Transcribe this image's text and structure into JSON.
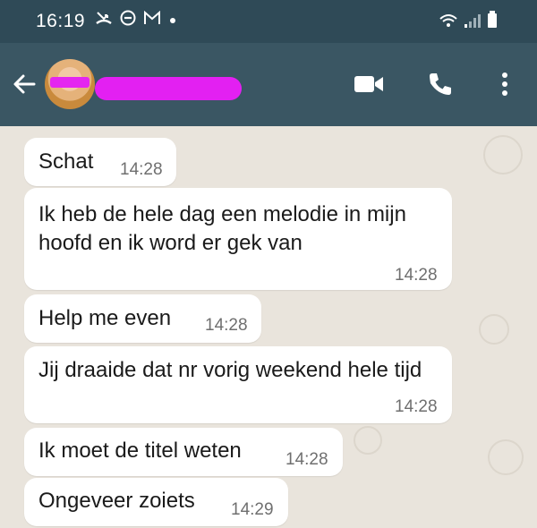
{
  "status_bar": {
    "time": "16:19",
    "icons": [
      "missed-call-icon",
      "do-not-disturb-icon",
      "gmail-icon",
      "notification-dot-icon"
    ],
    "right_icons": [
      "wifi-icon",
      "signal-icon",
      "battery-icon"
    ]
  },
  "app_bar": {
    "contact_name": "",
    "icons": [
      "back-arrow-icon",
      "video-call-icon",
      "voice-call-icon",
      "more-options-icon"
    ]
  },
  "messages": [
    {
      "text": "Schat",
      "time": "14:28"
    },
    {
      "text": "Ik heb de hele dag een melodie in mijn hoofd en ik word er gek van",
      "time": "14:28"
    },
    {
      "text": "Help me even",
      "time": "14:28"
    },
    {
      "text": "Jij draaide dat nr vorig weekend hele tijd",
      "time": "14:28"
    },
    {
      "text": "Ik moet de titel weten",
      "time": "14:28"
    },
    {
      "text": "Ongeveer zoiets",
      "time": "14:29"
    }
  ],
  "colors": {
    "status_bar": "#2f4a57",
    "app_bar": "#3a5663",
    "chat_background": "#e9e4dc",
    "bubble": "#ffffff",
    "redaction": "#e320f2"
  }
}
